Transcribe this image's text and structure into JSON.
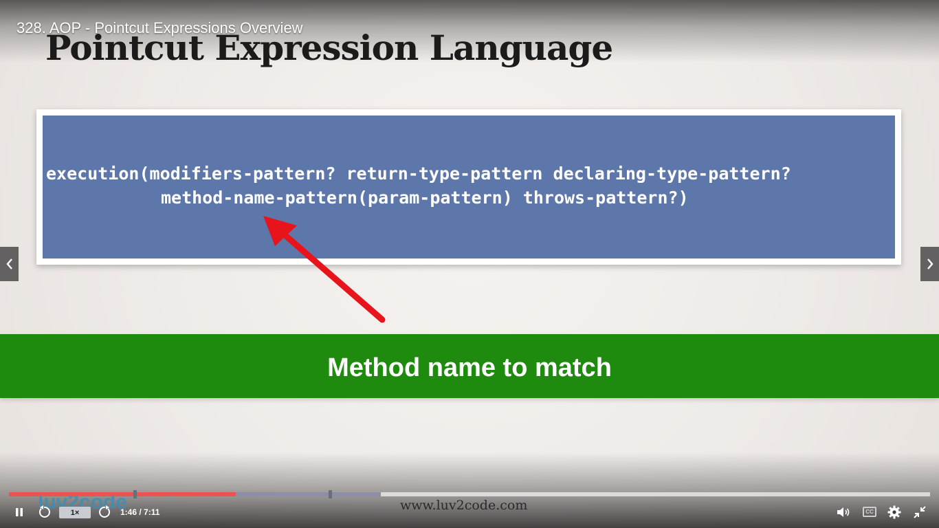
{
  "player": {
    "title": "328. AOP - Pointcut Expressions Overview",
    "speed": "1×",
    "time": "1:46 / 7:11",
    "progress": {
      "played_fraction": 0.2463,
      "buffered_fraction": 0.4034,
      "marker_fractions": [
        0.1365,
        0.3484
      ]
    },
    "accent_color": "#ec5252"
  },
  "slide": {
    "heading": "Pointcut Expression Language",
    "code_line_1": "execution(modifiers-pattern? return-type-pattern declaring-type-pattern?",
    "code_line_2": "method-name-pattern(param-pattern) throws-pattern?)",
    "banner": "Method name to match",
    "logo": "luv2code",
    "footer_url": "www.luv2code.com",
    "colors": {
      "code_box": "#5e77aa",
      "banner": "#1e8a0e",
      "arrow": "#e8141c"
    }
  },
  "icons": {
    "prev": "chevron-left-icon",
    "next": "chevron-right-icon",
    "pause": "pause-icon",
    "rewind": "rewind-5-icon",
    "forward": "forward-5-icon",
    "volume": "volume-icon",
    "captions": "captions-icon",
    "settings": "gear-icon",
    "exit_fullscreen": "exit-fullscreen-icon"
  },
  "captions_label": "CC"
}
